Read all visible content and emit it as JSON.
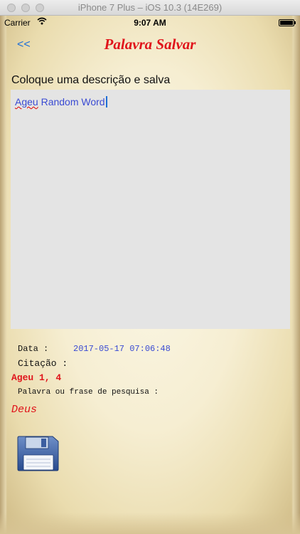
{
  "simulator": {
    "title": "iPhone 7 Plus – iOS 10.3 (14E269)"
  },
  "status_bar": {
    "carrier": "Carrier",
    "time": "9:07 AM"
  },
  "nav": {
    "back_label": "<<",
    "title": "Palavra Salvar"
  },
  "form": {
    "instructions": "Coloque uma descrição e salva",
    "description_misspelled": "Ageu",
    "description_rest": " Random Word"
  },
  "details": {
    "date_label": "Data :",
    "date_value": "2017-05-17 07:06:48",
    "citation_label": "Citação :",
    "citation_value": "Ageu 1, 4",
    "search_label": "Palavra ou frase de pesquisa :",
    "search_value": "Deus"
  },
  "icons": {
    "save": "floppy-disk-icon",
    "wifi": "wifi-icon",
    "battery": "battery-icon"
  },
  "colors": {
    "title_red": "#e0141b",
    "link_blue": "#1f6fd6",
    "value_blue": "#3a4bd3",
    "text_area_bg": "#e4e4e4"
  }
}
